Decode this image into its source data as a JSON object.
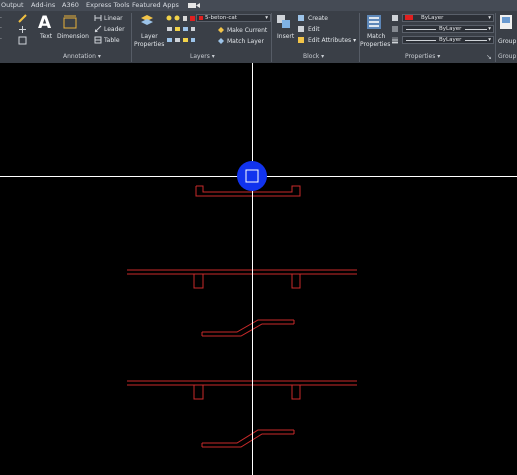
{
  "menu": {
    "items": [
      "Output",
      "Add-ins",
      "A360",
      "Express Tools",
      "Featured Apps"
    ]
  },
  "annotation": {
    "text_label": "Text",
    "dimension_label": "Dimension",
    "linear_label": "Linear",
    "leader_label": "Leader",
    "table_label": "Table",
    "panel_title": "Annotation"
  },
  "layers": {
    "properties_label_line1": "Layer",
    "properties_label_line2": "Properties",
    "current_layer": "5-beton-cat",
    "current_layer_color": "#e02020",
    "make_current_label": "Make Current",
    "match_layer_label": "Match Layer",
    "panel_title": "Layers"
  },
  "block": {
    "insert_label": "Insert",
    "create_label": "Create",
    "edit_label": "Edit",
    "edit_attributes_label": "Edit Attributes",
    "panel_title": "Block"
  },
  "properties": {
    "match_label_line1": "Match",
    "match_label_line2": "Properties",
    "color_value": "ByLayer",
    "color_swatch": "#e02020",
    "linetype_value": "ByLayer",
    "lineweight_value": "ByLayer",
    "panel_title": "Properties"
  },
  "groups": {
    "group_label": "Group",
    "panel_title": "Group"
  },
  "drawing": {
    "background": "#000000",
    "line_color": "#c92a2a",
    "crosshair_color": "#ffffff",
    "cursor_color": "#1133ee"
  }
}
